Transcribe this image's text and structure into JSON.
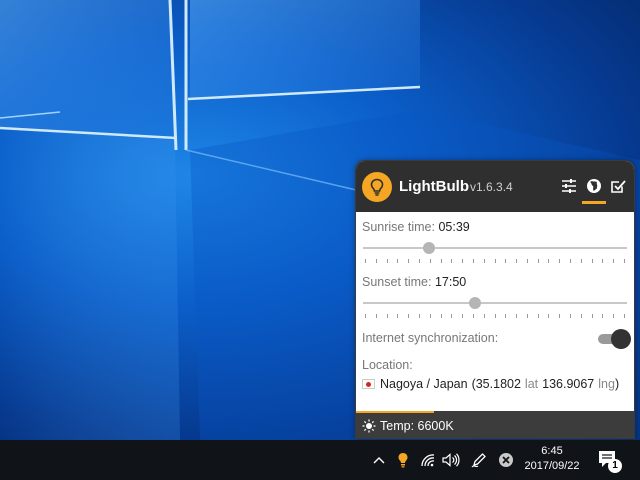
{
  "app": {
    "name": "LightBulb",
    "version": "v1.6.3.4",
    "accent_color": "#f5a623"
  },
  "header": {
    "buttons": [
      {
        "icon": "sliders-icon",
        "active": false
      },
      {
        "icon": "globe-icon",
        "active": true
      },
      {
        "icon": "checkbox-icon",
        "active": false
      }
    ]
  },
  "location_tab": {
    "sunrise_label": "Sunrise time:",
    "sunrise_value": "05:39",
    "sunrise_slider_fraction": 0.24,
    "sunset_label": "Sunset time:",
    "sunset_value": "17:50",
    "sunset_slider_fraction": 0.42,
    "internet_sync_label": "Internet synchronization:",
    "internet_sync_enabled": true,
    "location_label": "Location:",
    "flag_icon": "japan-flag-icon",
    "city_country": "Nagoya / Japan",
    "open_paren": "(",
    "latitude": "35.1802",
    "lat_unit": "lat",
    "longitude": "136.9067",
    "lng_unit": "lng",
    "close_paren": ")"
  },
  "footer": {
    "icon": "sun-icon",
    "temperature_text": "Temp: 6600K",
    "progress_fraction": 0.28
  },
  "taskbar": {
    "tray_icons": [
      "chevron-up-icon",
      "lightbulb-icon",
      "wifi-icon",
      "volume-icon",
      "pen-icon",
      "close-circle-icon"
    ],
    "time": "6:45",
    "date": "2017/09/22",
    "notification_count": "1"
  }
}
